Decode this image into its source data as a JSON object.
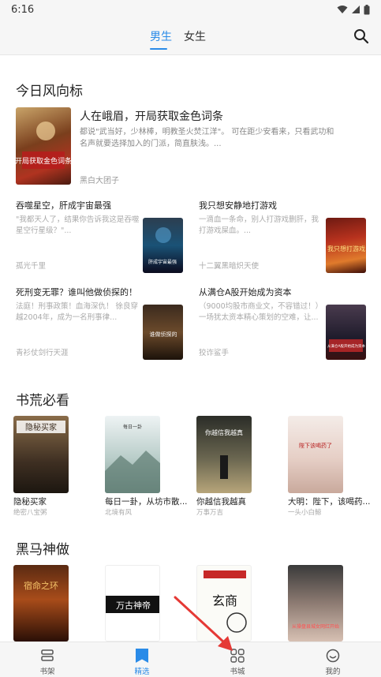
{
  "status_bar": {
    "time": "6:16"
  },
  "header": {
    "tabs": [
      {
        "label": "男生",
        "active": true
      },
      {
        "label": "女生",
        "active": false
      }
    ]
  },
  "section_today": {
    "title": "今日风向标",
    "feature": {
      "title": "人在峨眉，开局获取金色词条",
      "desc": "都说\"武当好，少林棒，明教圣火焚江洋\"。 可在距少安看来，只看武功和名声就要选择加入的门派，简直肤浅。...",
      "author": "黑白大团子",
      "cover_text": "开局获取金色词条"
    },
    "cards": [
      {
        "title": "吞噬星空，肝成宇宙最强",
        "desc": "\"我都天人了，结果你告诉我这是吞噬星空行星级？\"...",
        "author": "孤光千里",
        "cover_text": "肝成宇宙最强"
      },
      {
        "title": "我只想安静地打游戏",
        "desc": "一滴血一条命，别人打游戏删肝，我打游戏屎血。...",
        "author": "十二翼黑暗炽天使",
        "cover_text": "我只想打游戏"
      },
      {
        "title": "死刑变无罪？谁叫他做侦探的！",
        "desc": "法庭！刑事政策！血海深仇！ 徐良穿越2004年，成为一名刑事律...",
        "author": "青衫仗剑行天涯",
        "cover_text": "谁做侦探的"
      },
      {
        "title": "从满仓A股开始成为资本",
        "desc": "（9000均股市商业文，不容错过！）一场犹太资本精心策划的空难，让...",
        "author": "狡诈鲨手",
        "cover_text": "从满仓A股开始成为资本"
      }
    ]
  },
  "section_shuhuang": {
    "title": "书荒必看",
    "books": [
      {
        "title": "隐秘买家",
        "author": "绝密八宝粥",
        "cover_text": "隐秘买家"
      },
      {
        "title": "每日一卦，从坊市散...",
        "author": "北境有风",
        "cover_text": "每日一卦"
      },
      {
        "title": "你越信我越真",
        "author": "万事万吉",
        "cover_text": "你越信我越真"
      },
      {
        "title": "大明：陛下，该喝药...",
        "author": "一头小白鲸",
        "cover_text": "陛下该喝药了"
      }
    ]
  },
  "section_heima": {
    "title": "黑马神做",
    "books": [
      {
        "cover_text": "宿命之环"
      },
      {
        "cover_text": "万古神帝"
      },
      {
        "cover_text": "玄商"
      },
      {
        "cover_text": "从操盘县城女网红开始"
      }
    ]
  },
  "bottom_nav": [
    {
      "label": "书架",
      "icon": "bookshelf-icon",
      "active": false
    },
    {
      "label": "精选",
      "icon": "bookmark-icon",
      "active": true
    },
    {
      "label": "书城",
      "icon": "grid-icon",
      "active": false
    },
    {
      "label": "我的",
      "icon": "smile-icon",
      "active": false
    }
  ],
  "colors": {
    "accent": "#2a8be8",
    "arrow": "#e53935"
  }
}
